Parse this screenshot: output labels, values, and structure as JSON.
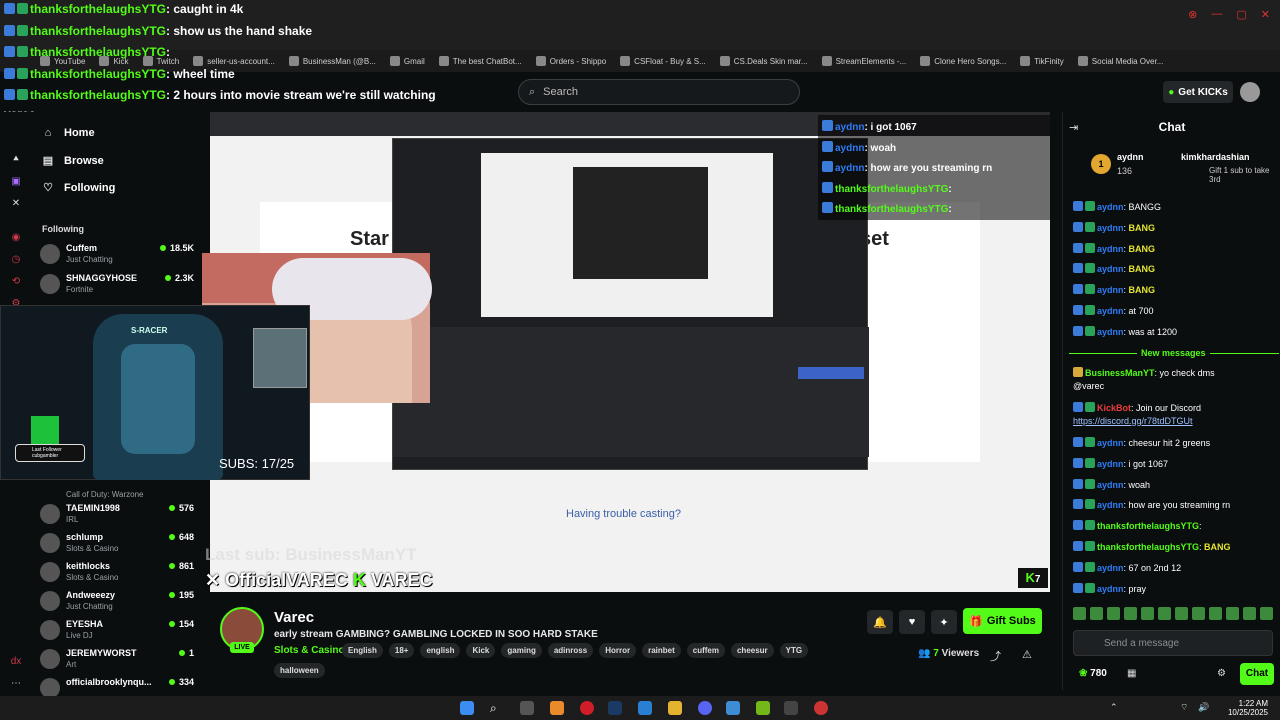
{
  "overlay_chat": [
    {
      "user": "thanksforthelaughsYTG",
      "msg": ": caught in 4k"
    },
    {
      "user": "thanksforthelaughsYTG",
      "msg": ": show us the hand shake"
    },
    {
      "user": "thanksforthelaughsYTG",
      "msg": ":"
    },
    {
      "user": "thanksforthelaughsYTG",
      "msg": ": wheel time"
    },
    {
      "user": "thanksforthelaughsYTG",
      "msg": ": 2 hours into movie stream we're still watching"
    }
  ],
  "overlay_chat_wrap": "varec",
  "bookmarks": [
    "YouTube",
    "Kick",
    "Twitch",
    "seller-us-account...",
    "BusinessMan (@B...",
    "Gmail",
    "The best ChatBot...",
    "Orders - Shippo",
    "CSFloat - Buy & S...",
    "CS.Deals Skin mar...",
    "StreamElements -...",
    "Clone Hero Songs...",
    "TikFinity",
    "Social Media Over..."
  ],
  "header": {
    "search_placeholder": "Search",
    "get_kicks": "Get KICKs"
  },
  "sidebar": {
    "nav": [
      {
        "label": "Home",
        "icon": "home-icon"
      },
      {
        "label": "Browse",
        "icon": "browse-icon"
      },
      {
        "label": "Following",
        "icon": "heart-icon"
      }
    ],
    "following_header": "Following",
    "channels_top": [
      {
        "name": "Cuffem",
        "category": "Just Chatting",
        "viewers": "18.5K"
      },
      {
        "name": "SHNAGGYHOSE",
        "category": "Fortnite",
        "viewers": "2.3K"
      }
    ],
    "channels_bottom": [
      {
        "name": "Call of Duty: Warzone",
        "category": "",
        "viewers": ""
      },
      {
        "name": "TAEMIN1998",
        "category": "IRL",
        "viewers": "576"
      },
      {
        "name": "schlump",
        "category": "Slots & Casino",
        "viewers": "648"
      },
      {
        "name": "keithlocks",
        "category": "Slots & Casino",
        "viewers": "861"
      },
      {
        "name": "Andweeezy",
        "category": "Just Chatting",
        "viewers": "195"
      },
      {
        "name": "EYESHA",
        "category": "Live DJ",
        "viewers": "154"
      },
      {
        "name": "JEREMYWORST",
        "category": "Art",
        "viewers": "1"
      },
      {
        "name": "officialbrooklynqu...",
        "category": "",
        "viewers": "334"
      }
    ]
  },
  "video": {
    "big_text_left": "Star",
    "big_text_right": "set",
    "trouble": "Having trouble casting?",
    "last_sub": "Last sub: BusinessManYT",
    "official": "OfficialVAREC",
    "varec": "VAREC",
    "subs": "SUBS: 17/25",
    "last_follower": "Last Follower",
    "last_follower_name": "cubgambler",
    "chair_brand": "S-RACER",
    "vchat": [
      {
        "user": "aydnn",
        "msg": ": i got 1067"
      },
      {
        "user": "aydnn",
        "msg": ": woah"
      },
      {
        "user": "aydnn",
        "msg": ": how are you streaming rn"
      },
      {
        "user": "thanksforthelaughsYTG",
        "msg": ":"
      },
      {
        "user": "thanksforthelaughsYTG",
        "msg": ":"
      }
    ]
  },
  "stream": {
    "name": "Varec",
    "title": "early stream GAMBING? GAMBLING LOCKED IN SOO HARD STAKE",
    "category": "Slots & Casino",
    "tags": [
      "English",
      "18+",
      "english",
      "Kick",
      "gaming",
      "adinross",
      "Horror",
      "rainbet",
      "cuffem",
      "cheesur",
      "YTG"
    ],
    "tags2": [
      "halloween"
    ],
    "live": "LIVE",
    "gift_subs": "Gift Subs",
    "viewers": "7",
    "viewers_label": "Viewers"
  },
  "chat": {
    "header": "Chat",
    "pinned_user1": "aydnn",
    "pinned_user2": "kimkhardashian",
    "pinned_count1": "136",
    "pinned_count2": "Gift 1 sub to take 3rd",
    "pinned_coin": "1",
    "messages_before": [
      {
        "user": "aydnn",
        "msg": "BANGG",
        "cls": "u-ayd"
      },
      {
        "user": "aydnn",
        "msg": "BANG",
        "cls": "u-ayd",
        "bang": true
      },
      {
        "user": "aydnn",
        "msg": "BANG",
        "cls": "u-ayd",
        "bang": true
      },
      {
        "user": "aydnn",
        "msg": "BANG",
        "cls": "u-ayd",
        "bang": true
      },
      {
        "user": "aydnn",
        "msg": "BANG",
        "cls": "u-ayd",
        "bang": true
      },
      {
        "user": "aydnn",
        "msg": "at 700",
        "cls": "u-ayd"
      },
      {
        "user": "aydnn",
        "msg": "was at 1200",
        "cls": "u-ayd"
      }
    ],
    "new_messages": "New messages",
    "business_user": "BusinessManYT",
    "business_msg": "yo check dms",
    "business_mention": "@varec",
    "bot_user": "KickBot",
    "bot_msg": "Join our Discord",
    "bot_link": "https://discord.gg/r78tdDTGUt",
    "messages_after": [
      {
        "user": "aydnn",
        "msg": "cheesur hit 2 greens",
        "cls": "u-ayd"
      },
      {
        "user": "aydnn",
        "msg": "i got 1067",
        "cls": "u-ayd"
      },
      {
        "user": "aydnn",
        "msg": "woah",
        "cls": "u-ayd"
      },
      {
        "user": "aydnn",
        "msg": "how are you streaming rn",
        "cls": "u-ayd"
      },
      {
        "user": "thanksforthelaughsYTG",
        "msg": "",
        "cls": "u-thx"
      },
      {
        "user": "thanksforthelaughsYTG",
        "msg": "BANG",
        "cls": "u-thx",
        "bang": true
      },
      {
        "user": "aydnn",
        "msg": "67 on 2nd 12",
        "cls": "u-ayd"
      },
      {
        "user": "aydnn",
        "msg": "pray",
        "cls": "u-ayd"
      }
    ],
    "send_placeholder": "Send a message",
    "points": "780",
    "chat_button": "Chat"
  },
  "taskbar": {
    "time": "1:22 AM",
    "date": "10/25/2025"
  },
  "colors": {
    "kick_green": "#53fc18",
    "bg": "#0b0e0f",
    "ayd_blue": "#2e7cf6"
  }
}
